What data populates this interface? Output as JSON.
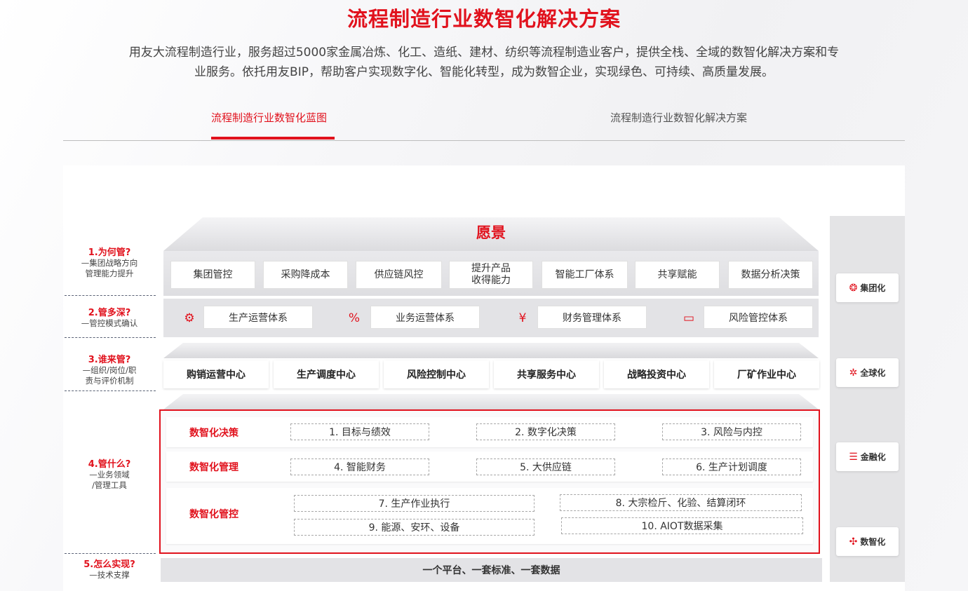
{
  "header": {
    "title": "流程制造行业数智化解决方案",
    "intro_line1": "用友大流程制造行业，服务超过5000家金属冶炼、化工、造纸、建材、纺织等流程制造业客户，提供全栈、全域的数智化解决方案和专",
    "intro_line2": "业服务。依托用友BIP，帮助客户实现数字化、智能化转型，成为数智企业，实现绿色、可持续、高质量发展。"
  },
  "tabs": [
    {
      "label": "流程制造行业数智化蓝图",
      "active": true
    },
    {
      "label": "流程制造行业数智化解决方案",
      "active": false
    }
  ],
  "accent_color": "#e1121d",
  "left_labels": [
    {
      "q": "1.为何管?",
      "d1": "—集团战略方向",
      "d2": "管理能力提升"
    },
    {
      "q": "2.管多深?",
      "d1": "—管控模式确认",
      "d2": ""
    },
    {
      "q": "3.谁来管?",
      "d1": "—组织/岗位/职",
      "d2": "责与评价机制"
    },
    {
      "q": "4.管什么?",
      "d1": "—业务领域",
      "d2": "/管理工具"
    },
    {
      "q": "5.怎么实现?",
      "d1": "—技术支撑",
      "d2": ""
    }
  ],
  "vision": "愿景",
  "goals": [
    {
      "l1": "集团管控",
      "l2": ""
    },
    {
      "l1": "采购降成本",
      "l2": ""
    },
    {
      "l1": "供应链风控",
      "l2": ""
    },
    {
      "l1": "提升产品",
      "l2": "收得能力"
    },
    {
      "l1": "智能工厂体系",
      "l2": ""
    },
    {
      "l1": "共享赋能",
      "l2": ""
    },
    {
      "l1": "数据分析决策",
      "l2": ""
    }
  ],
  "systems": [
    {
      "label": "生产运营体系",
      "icon": "robot-arm-icon",
      "glyph": "⚙"
    },
    {
      "label": "业务运营体系",
      "icon": "percent-icon",
      "glyph": "%"
    },
    {
      "label": "财务管理体系",
      "icon": "yen-icon",
      "glyph": "¥"
    },
    {
      "label": "风险管控体系",
      "icon": "monitor-chart-icon",
      "glyph": "▭"
    }
  ],
  "centers": [
    "购销运营中心",
    "生产调度中心",
    "风险控制中心",
    "共享服务中心",
    "战略投资中心",
    "厂矿作业中心"
  ],
  "digital": {
    "decision": {
      "title": "数智化决策",
      "items": [
        "1. 目标与绩效",
        "2. 数字化决策",
        "3. 风险与内控"
      ]
    },
    "management": {
      "title": "数智化管理",
      "items": [
        "4. 智能财务",
        "5. 大供应链",
        "6. 生产计划调度"
      ]
    },
    "control": {
      "title": "数智化管控",
      "items": [
        "7. 生产作业执行",
        "8. 大宗检斤、化验、结算闭环",
        "9. 能源、安环、设备",
        "10. AIOT数据采集"
      ]
    }
  },
  "platform": "一个平台、一套标准、一套数据",
  "side": [
    {
      "label": "集团化",
      "icon": "group-icon",
      "glyph": "❂"
    },
    {
      "label": "全球化",
      "icon": "globe-icon",
      "glyph": "✲"
    },
    {
      "label": "金融化",
      "icon": "database-icon",
      "glyph": "☰"
    },
    {
      "label": "数智化",
      "icon": "cluster-icon",
      "glyph": "✣"
    }
  ]
}
